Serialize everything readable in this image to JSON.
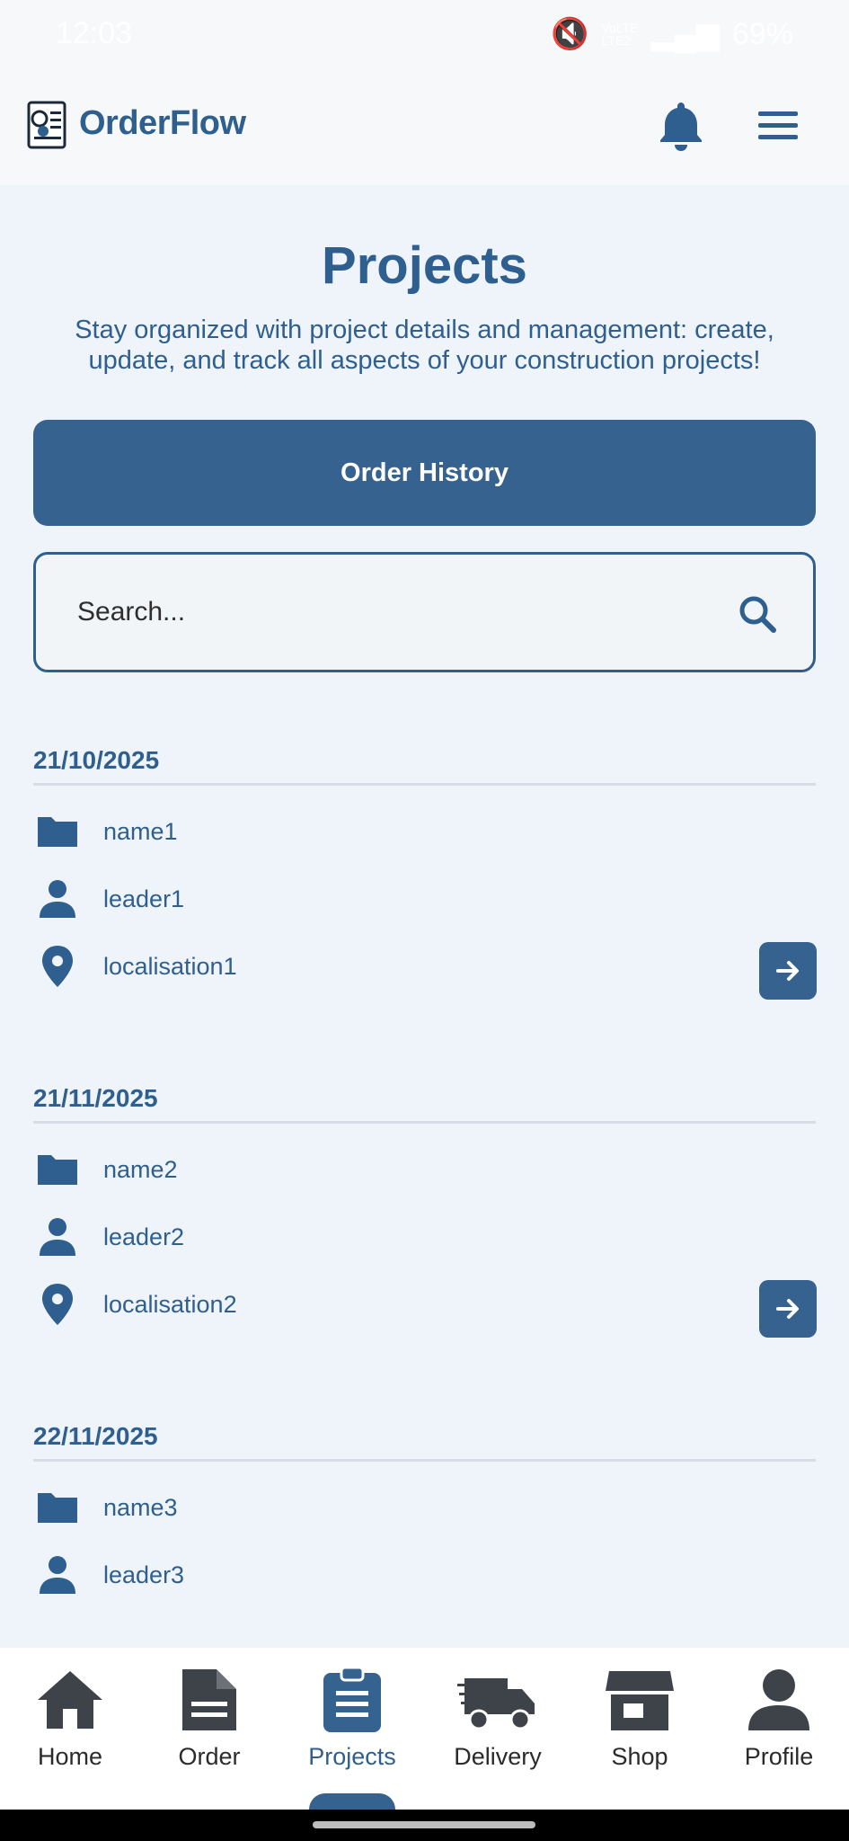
{
  "status_bar": {
    "time": "12:03",
    "network_top": "VoLTE",
    "network_bottom": "LTE2",
    "battery": "69%"
  },
  "header": {
    "brand": "OrderFlow",
    "icons": [
      "logo-icon",
      "bell-icon",
      "menu-icon"
    ]
  },
  "page": {
    "title": "Projects",
    "subtitle": "Stay organized with project details and management: create, update, and track all aspects of your construction projects!"
  },
  "order_history_label": "Order History",
  "search": {
    "placeholder": "Search..."
  },
  "projects": [
    {
      "date": "21/10/2025",
      "name": "name1",
      "leader": "leader1",
      "location": "localisation1"
    },
    {
      "date": "21/11/2025",
      "name": "name2",
      "leader": "leader2",
      "location": "localisation2"
    },
    {
      "date": "22/11/2025",
      "name": "name3",
      "leader": "leader3"
    }
  ],
  "nav": {
    "items": [
      {
        "label": "Home",
        "icon": "home-icon"
      },
      {
        "label": "Order",
        "icon": "document-icon"
      },
      {
        "label": "Projects",
        "icon": "clipboard-icon",
        "active": true
      },
      {
        "label": "Delivery",
        "icon": "truck-icon"
      },
      {
        "label": "Shop",
        "icon": "store-icon"
      },
      {
        "label": "Profile",
        "icon": "person-icon"
      }
    ]
  },
  "colors": {
    "primary": "#35628e",
    "text_primary": "#2f5f8f",
    "background": "#eff4fa"
  }
}
